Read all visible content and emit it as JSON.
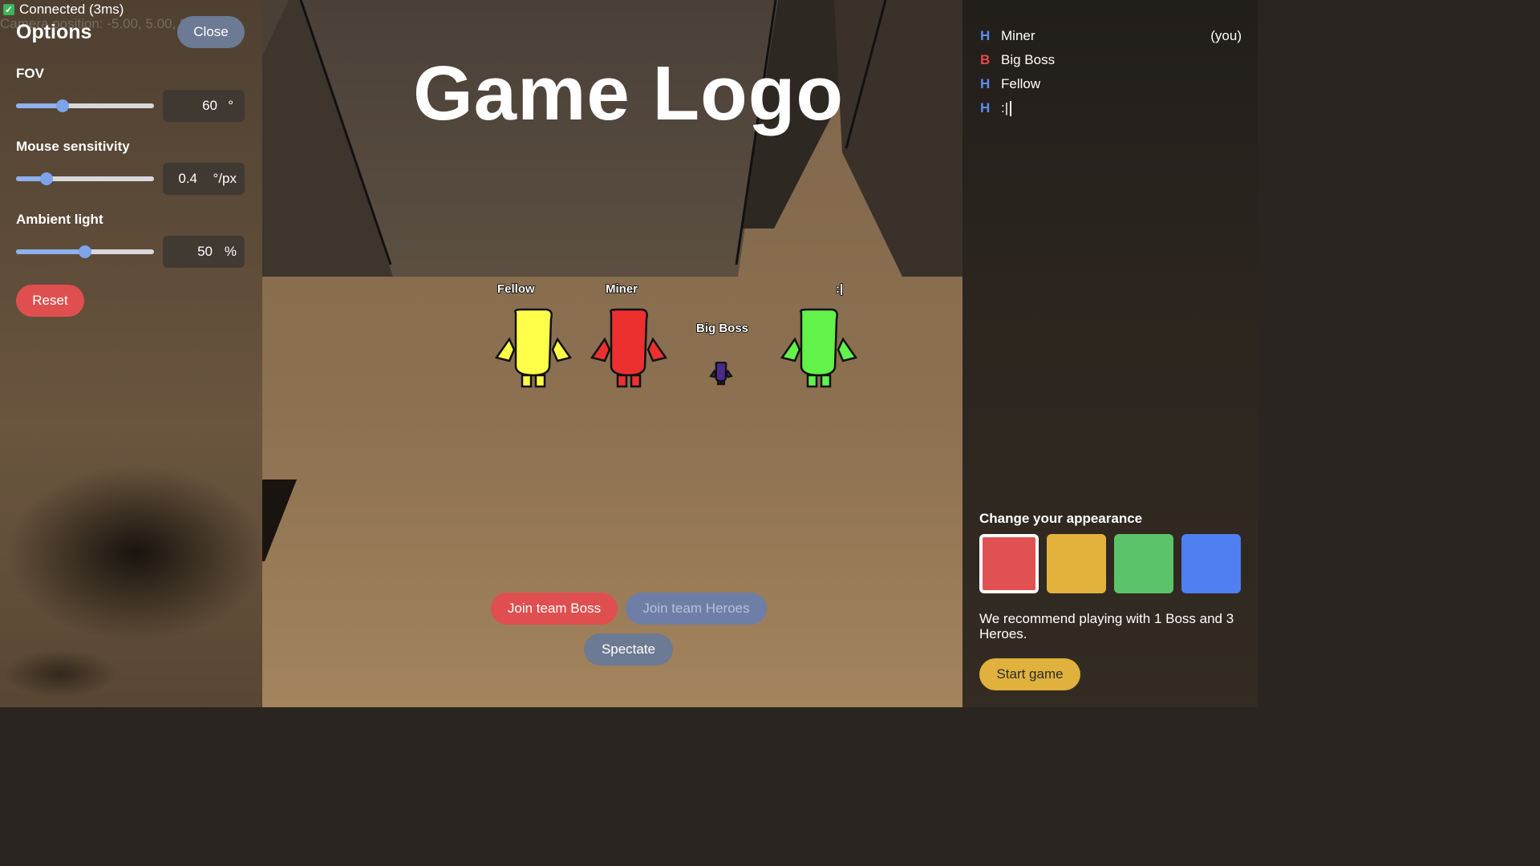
{
  "status": {
    "connected": "Connected (3ms)",
    "camera": "Camera position: -5.00, 5.00, 8.00"
  },
  "options": {
    "title": "Options",
    "close_label": "Close",
    "fov": {
      "label": "FOV",
      "value": "60",
      "unit": "°",
      "fraction": 0.34
    },
    "mouse": {
      "label": "Mouse sensitivity",
      "value": "0.4",
      "unit": "°/px",
      "fraction": 0.22
    },
    "ambient": {
      "label": "Ambient light",
      "value": "50",
      "unit": "%",
      "fraction": 0.5
    },
    "reset_label": "Reset"
  },
  "game": {
    "logo": "Game Logo",
    "characters": [
      {
        "name": "Fellow",
        "color": "#ffff4a"
      },
      {
        "name": "Miner",
        "color": "#ec3030"
      },
      {
        "name": "Big Boss",
        "color": "#4a2a8a"
      },
      {
        "name": ":|",
        "color": "#62f24a"
      }
    ]
  },
  "buttons": {
    "join_boss": "Join team Boss",
    "join_heroes": "Join team Heroes",
    "spectate": "Spectate"
  },
  "players": [
    {
      "team": "H",
      "team_color": "#5b8cf0",
      "name": "Miner",
      "suffix": "(you)"
    },
    {
      "team": "B",
      "team_color": "#e24a4a",
      "name": "Big Boss",
      "suffix": ""
    },
    {
      "team": "H",
      "team_color": "#5b8cf0",
      "name": "Fellow",
      "suffix": ""
    },
    {
      "team": "H",
      "team_color": "#5b8cf0",
      "name": ":|",
      "suffix": ""
    }
  ],
  "appearance": {
    "title": "Change your appearance",
    "swatches": [
      "#e05252",
      "#e2b23c",
      "#5bc46a",
      "#4f7ff0"
    ],
    "selected_index": 0
  },
  "recommend": "We recommend playing with 1 Boss and 3 Heroes.",
  "start_label": "Start game"
}
